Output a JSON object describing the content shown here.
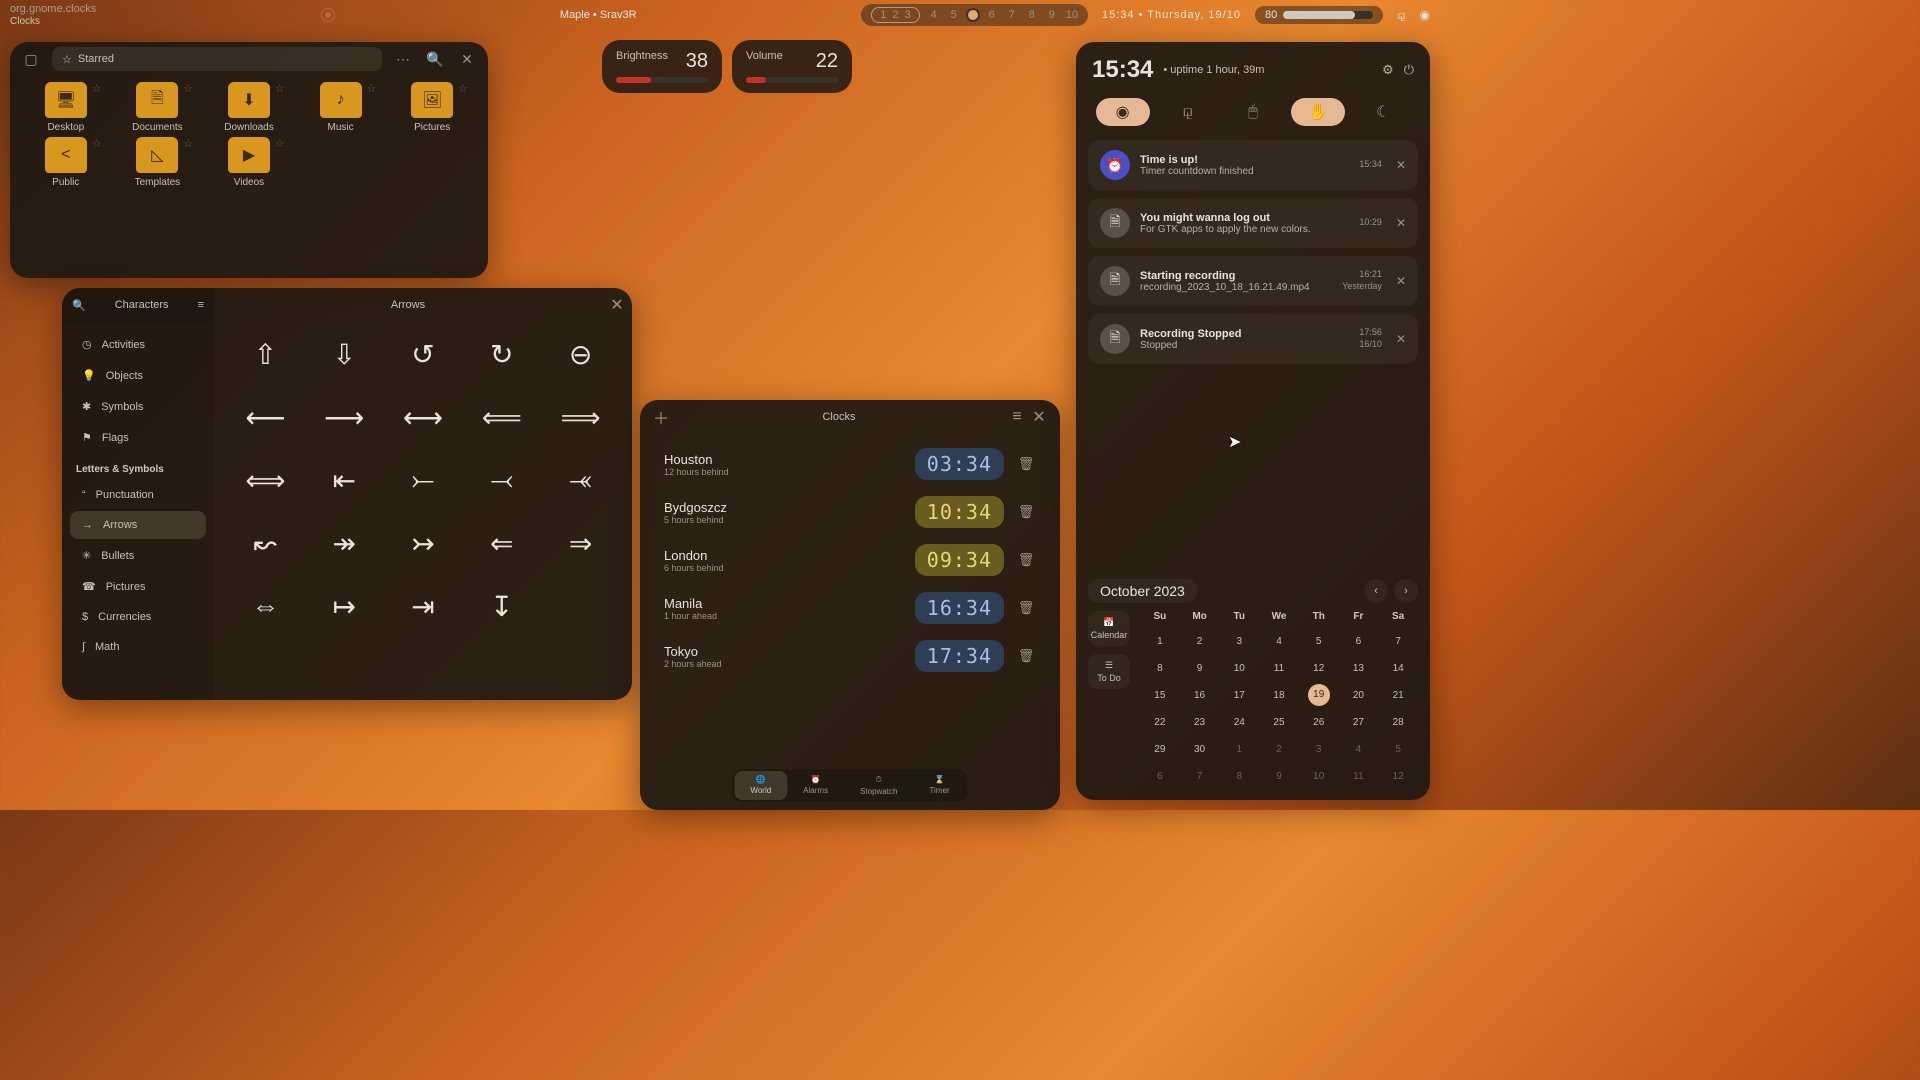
{
  "topbar": {
    "app_id": "org.gnome.clocks",
    "app_name": "Clocks",
    "session": "Maple • Srav3R",
    "workspaces": [
      "1",
      "2",
      "3",
      "4",
      "5",
      "6",
      "7",
      "8",
      "9",
      "10"
    ],
    "active_group": [
      0,
      1,
      2
    ],
    "time": "15:34",
    "date": "Thursday, 19/10",
    "battery": "80"
  },
  "osd": {
    "brightness_label": "Brightness",
    "brightness_val": "38",
    "volume_label": "Volume",
    "volume_val": "22"
  },
  "files": {
    "title": "Starred",
    "folders": [
      {
        "name": "Desktop",
        "glyph": "🖥"
      },
      {
        "name": "Documents",
        "glyph": "🗎"
      },
      {
        "name": "Downloads",
        "glyph": "⬇"
      },
      {
        "name": "Music",
        "glyph": "♪"
      },
      {
        "name": "Pictures",
        "glyph": "🖼"
      },
      {
        "name": "Public",
        "glyph": "<"
      },
      {
        "name": "Templates",
        "glyph": "◺"
      },
      {
        "name": "Videos",
        "glyph": "▶"
      }
    ]
  },
  "chars": {
    "sidebar_title": "Characters",
    "content_title": "Arrows",
    "section_label": "Letters & Symbols",
    "items": [
      {
        "label": "Activities",
        "icon": "◷"
      },
      {
        "label": "Objects",
        "icon": "💡"
      },
      {
        "label": "Symbols",
        "icon": "✱"
      },
      {
        "label": "Flags",
        "icon": "⚑"
      }
    ],
    "items2": [
      {
        "label": "Punctuation",
        "icon": "“"
      },
      {
        "label": "Arrows",
        "icon": "→",
        "selected": true
      },
      {
        "label": "Bullets",
        "icon": "✳"
      },
      {
        "label": "Pictures",
        "icon": "☎"
      },
      {
        "label": "Currencies",
        "icon": "$"
      },
      {
        "label": "Math",
        "icon": "∫"
      }
    ],
    "glyphs": [
      "⇧",
      "⇩",
      "↺",
      "↻",
      "⊖",
      "⟵",
      "⟶",
      "⟷",
      "⟸",
      "⟹",
      "⟺",
      "⇤",
      "⤚",
      "⤙",
      "⤛",
      "↜",
      "↠",
      "↣",
      "⇐",
      "⇒",
      "⇔",
      "↦",
      "⇥",
      "↧"
    ]
  },
  "clocks": {
    "title": "Clocks",
    "rows": [
      {
        "city": "Houston",
        "sub": "12 hours behind",
        "time": "03:34",
        "cls": "night"
      },
      {
        "city": "Bydgoszcz",
        "sub": "5 hours behind",
        "time": "10:34",
        "cls": "day"
      },
      {
        "city": "London",
        "sub": "6 hours behind",
        "time": "09:34",
        "cls": "day"
      },
      {
        "city": "Manila",
        "sub": "1 hour ahead",
        "time": "16:34",
        "cls": "night"
      },
      {
        "city": "Tokyo",
        "sub": "2 hours ahead",
        "time": "17:34",
        "cls": "night"
      }
    ],
    "tabs": [
      {
        "label": "World",
        "icon": "🌐",
        "active": true
      },
      {
        "label": "Alarms",
        "icon": "⏰"
      },
      {
        "label": "Stopwatch",
        "icon": "⏱"
      },
      {
        "label": "Timer",
        "icon": "⌛"
      }
    ]
  },
  "panel": {
    "time": "15:34",
    "uptime": "• uptime 1 hour, 39m",
    "notifs": [
      {
        "title": "Time is up!",
        "body": "Timer countdown finished",
        "time": "15:34",
        "icon": "⏰",
        "cls": ""
      },
      {
        "title": "You might wanna log out",
        "body": "For GTK apps to apply the new colors.",
        "time": "10:29",
        "icon": "🗎",
        "cls": "alt"
      },
      {
        "title": "Starting recording",
        "body": "recording_2023_10_18_16.21.49.mp4",
        "time": "16:21",
        "time2": "Yesterday",
        "icon": "🗎",
        "cls": "alt"
      },
      {
        "title": "Recording Stopped",
        "body": "Stopped",
        "time": "17:56",
        "time2": "16/10",
        "icon": "🗎",
        "cls": "alt"
      }
    ],
    "cal": {
      "month": "October 2023",
      "dow": [
        "Su",
        "Mo",
        "Tu",
        "We",
        "Th",
        "Fr",
        "Sa"
      ],
      "side": [
        {
          "label": "Calendar",
          "icon": "📅"
        },
        {
          "label": "To Do",
          "icon": "☰"
        }
      ],
      "days": [
        [
          1,
          2,
          3,
          4,
          5,
          6,
          7
        ],
        [
          8,
          9,
          10,
          11,
          12,
          13,
          14
        ],
        [
          15,
          16,
          17,
          18,
          19,
          20,
          21
        ],
        [
          22,
          23,
          24,
          25,
          26,
          27,
          28
        ],
        [
          29,
          30,
          1,
          2,
          3,
          4,
          5
        ],
        [
          6,
          7,
          8,
          9,
          10,
          11,
          12
        ]
      ],
      "today": 19,
      "dim_after": 30
    }
  }
}
